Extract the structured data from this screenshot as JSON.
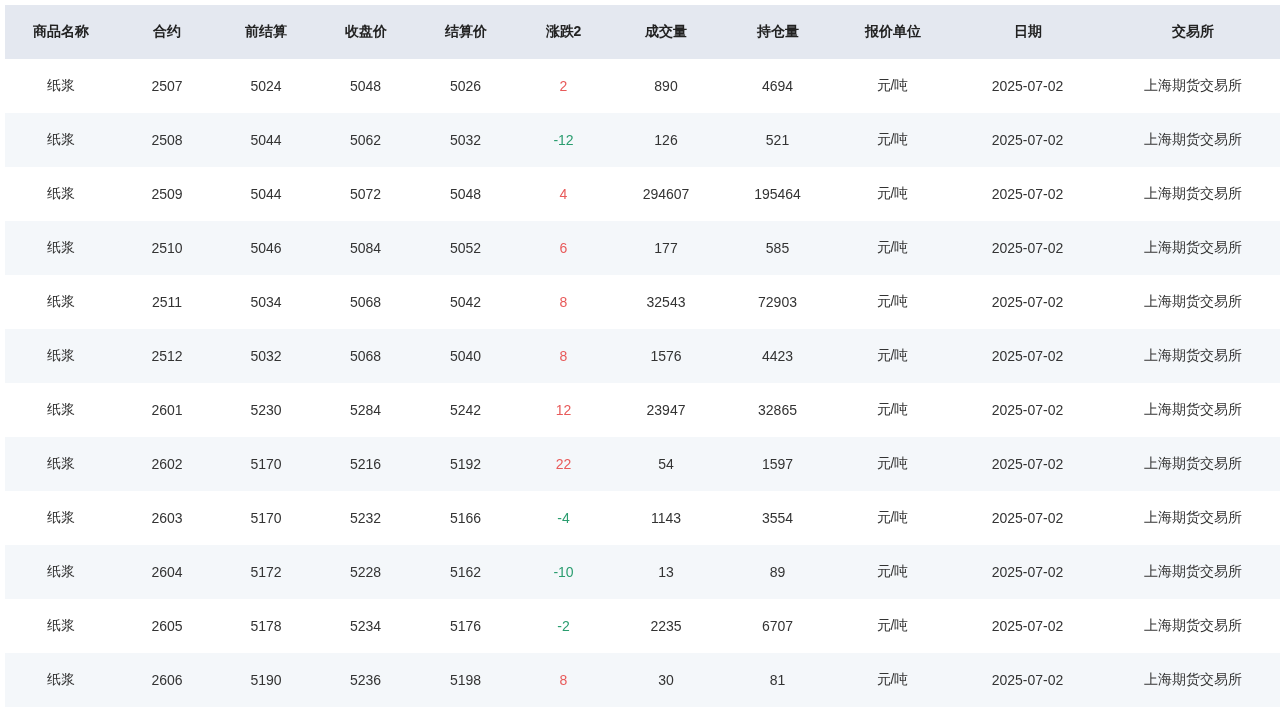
{
  "table": {
    "columns": [
      {
        "label": "商品名称",
        "kind": "text"
      },
      {
        "label": "合约",
        "kind": "text"
      },
      {
        "label": "前结算",
        "kind": "text"
      },
      {
        "label": "收盘价",
        "kind": "text"
      },
      {
        "label": "结算价",
        "kind": "text"
      },
      {
        "label": "涨跌2",
        "kind": "change"
      },
      {
        "label": "成交量",
        "kind": "text"
      },
      {
        "label": "持仓量",
        "kind": "text"
      },
      {
        "label": "报价单位",
        "kind": "text"
      },
      {
        "label": "日期",
        "kind": "text"
      },
      {
        "label": "交易所",
        "kind": "text"
      }
    ],
    "rows": [
      {
        "rising": true,
        "cells": [
          "纸浆",
          "2507",
          "5024",
          "5048",
          "5026",
          "2",
          "890",
          "4694",
          "元/吨",
          "2025-07-02",
          "上海期货交易所"
        ]
      },
      {
        "rising": false,
        "cells": [
          "纸浆",
          "2508",
          "5044",
          "5062",
          "5032",
          "-12",
          "126",
          "521",
          "元/吨",
          "2025-07-02",
          "上海期货交易所"
        ]
      },
      {
        "rising": true,
        "cells": [
          "纸浆",
          "2509",
          "5044",
          "5072",
          "5048",
          "4",
          "294607",
          "195464",
          "元/吨",
          "2025-07-02",
          "上海期货交易所"
        ]
      },
      {
        "rising": true,
        "cells": [
          "纸浆",
          "2510",
          "5046",
          "5084",
          "5052",
          "6",
          "177",
          "585",
          "元/吨",
          "2025-07-02",
          "上海期货交易所"
        ]
      },
      {
        "rising": true,
        "cells": [
          "纸浆",
          "2511",
          "5034",
          "5068",
          "5042",
          "8",
          "32543",
          "72903",
          "元/吨",
          "2025-07-02",
          "上海期货交易所"
        ]
      },
      {
        "rising": true,
        "cells": [
          "纸浆",
          "2512",
          "5032",
          "5068",
          "5040",
          "8",
          "1576",
          "4423",
          "元/吨",
          "2025-07-02",
          "上海期货交易所"
        ]
      },
      {
        "rising": true,
        "cells": [
          "纸浆",
          "2601",
          "5230",
          "5284",
          "5242",
          "12",
          "23947",
          "32865",
          "元/吨",
          "2025-07-02",
          "上海期货交易所"
        ]
      },
      {
        "rising": true,
        "cells": [
          "纸浆",
          "2602",
          "5170",
          "5216",
          "5192",
          "22",
          "54",
          "1597",
          "元/吨",
          "2025-07-02",
          "上海期货交易所"
        ]
      },
      {
        "rising": false,
        "cells": [
          "纸浆",
          "2603",
          "5170",
          "5232",
          "5166",
          "-4",
          "1143",
          "3554",
          "元/吨",
          "2025-07-02",
          "上海期货交易所"
        ]
      },
      {
        "rising": false,
        "cells": [
          "纸浆",
          "2604",
          "5172",
          "5228",
          "5162",
          "-10",
          "13",
          "89",
          "元/吨",
          "2025-07-02",
          "上海期货交易所"
        ]
      },
      {
        "rising": false,
        "cells": [
          "纸浆",
          "2605",
          "5178",
          "5234",
          "5176",
          "-2",
          "2235",
          "6707",
          "元/吨",
          "2025-07-02",
          "上海期货交易所"
        ]
      },
      {
        "rising": true,
        "cells": [
          "纸浆",
          "2606",
          "5190",
          "5236",
          "5198",
          "8",
          "30",
          "81",
          "元/吨",
          "2025-07-02",
          "上海期货交易所"
        ]
      }
    ]
  }
}
